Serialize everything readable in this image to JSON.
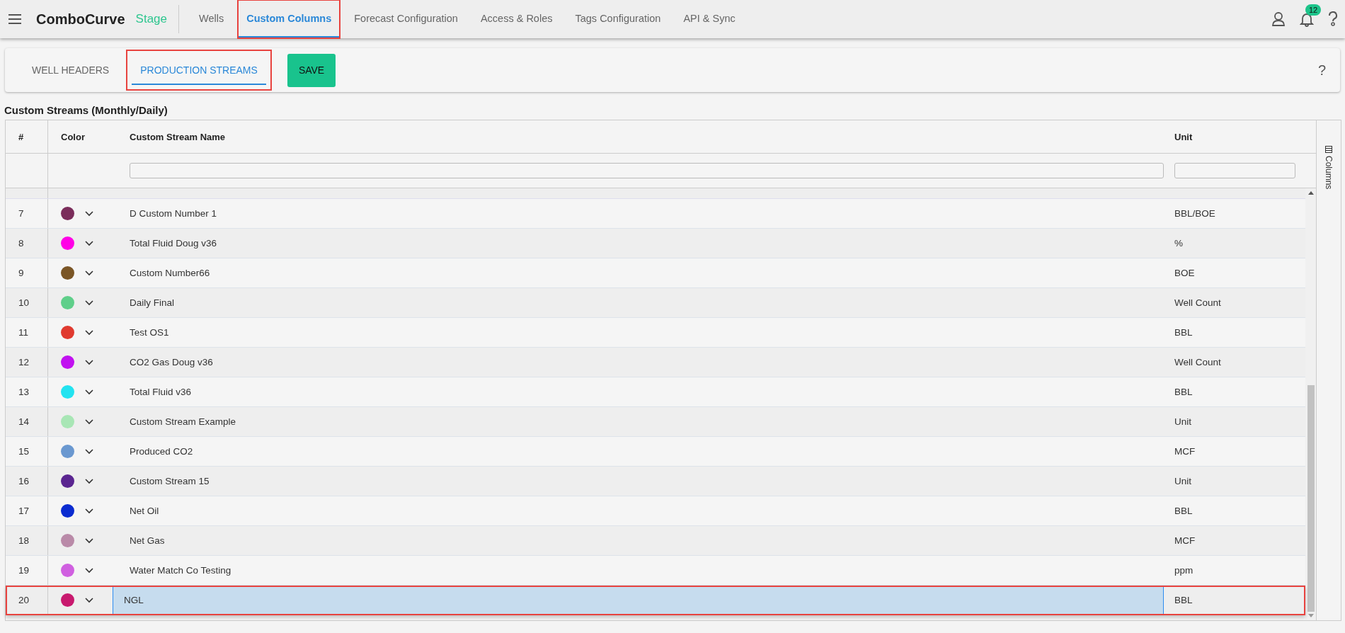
{
  "app": {
    "name": "ComboCurve",
    "environment": "Stage",
    "notification_count": "12"
  },
  "nav_tabs": [
    {
      "label": "Wells",
      "selected": false,
      "highlighted": false
    },
    {
      "label": "Custom Columns",
      "selected": true,
      "highlighted": true
    },
    {
      "label": "Forecast Configuration",
      "selected": false,
      "highlighted": false
    },
    {
      "label": "Access & Roles",
      "selected": false,
      "highlighted": false
    },
    {
      "label": "Tags Configuration",
      "selected": false,
      "highlighted": false
    },
    {
      "label": "API & Sync",
      "selected": false,
      "highlighted": false
    }
  ],
  "sub_tabs": [
    {
      "label": "WELL HEADERS",
      "selected": false,
      "highlighted": false
    },
    {
      "label": "PRODUCTION STREAMS",
      "selected": true,
      "highlighted": true
    }
  ],
  "save_button": "SAVE",
  "help_button": "?",
  "section_title": "Custom Streams (Monthly/Daily)",
  "table": {
    "columns": [
      "#",
      "Color",
      "Custom Stream Name",
      "Unit"
    ],
    "side_panel": "Columns",
    "rows": [
      {
        "index": "7",
        "color": "#7b2d5b",
        "name": "D Custom Number 1",
        "unit": "BBL/BOE",
        "selected": false
      },
      {
        "index": "8",
        "color": "#ff00e6",
        "name": "Total Fluid Doug v36",
        "unit": "%",
        "selected": false
      },
      {
        "index": "9",
        "color": "#7a5525",
        "name": "Custom Number66",
        "unit": "BOE",
        "selected": false
      },
      {
        "index": "10",
        "color": "#5fcf8a",
        "name": "Daily Final",
        "unit": "Well Count",
        "selected": false
      },
      {
        "index": "11",
        "color": "#e03a2f",
        "name": "Test OS1",
        "unit": "BBL",
        "selected": false
      },
      {
        "index": "12",
        "color": "#c111f0",
        "name": "CO2 Gas Doug v36",
        "unit": "Well Count",
        "selected": false
      },
      {
        "index": "13",
        "color": "#22e3f0",
        "name": "Total Fluid v36",
        "unit": "BBL",
        "selected": false
      },
      {
        "index": "14",
        "color": "#a8e6b5",
        "name": "Custom Stream Example",
        "unit": "Unit",
        "selected": false
      },
      {
        "index": "15",
        "color": "#6a98d0",
        "name": "Produced CO2",
        "unit": "MCF",
        "selected": false
      },
      {
        "index": "16",
        "color": "#5a2590",
        "name": "Custom Stream 15",
        "unit": "Unit",
        "selected": false
      },
      {
        "index": "17",
        "color": "#0a2bd0",
        "name": "Net Oil",
        "unit": "BBL",
        "selected": false
      },
      {
        "index": "18",
        "color": "#b98aa8",
        "name": "Net Gas",
        "unit": "MCF",
        "selected": false
      },
      {
        "index": "19",
        "color": "#d060e0",
        "name": "Water Match Co Testing",
        "unit": "ppm",
        "selected": false
      },
      {
        "index": "20",
        "color": "#c8196e",
        "name": "NGL",
        "unit": "BBL",
        "selected": true
      }
    ]
  }
}
